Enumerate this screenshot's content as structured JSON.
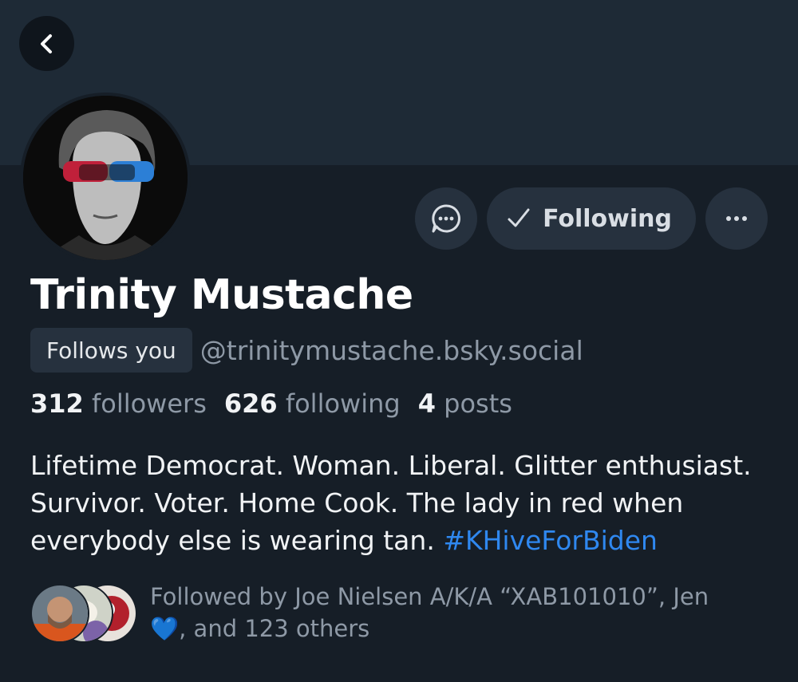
{
  "header": {
    "back_label": "Back"
  },
  "profile": {
    "display_name": "Trinity Mustache",
    "follows_you": "Follows you",
    "handle": "@trinitymustache.bsky.social"
  },
  "actions": {
    "following_label": "Following",
    "message_icon": "chat-bubble-icon",
    "more_icon": "more-horizontal-icon"
  },
  "stats": {
    "followers_count": "312",
    "followers_label": "followers",
    "following_count": "626",
    "following_label": "following",
    "posts_count": "4",
    "posts_label": "posts"
  },
  "bio": {
    "text": "Lifetime Democrat. Woman. Liberal. Glitter enthusiast. Survivor. Voter. Home Cook. The lady in red when everybody else is wearing tan. ",
    "hashtag": "#KHiveForBiden"
  },
  "followed_by": {
    "prefix": "Followed by Joe Nielsen A/K/A “XAB101010”, Jen ",
    "heart": "💙",
    "suffix": ", and 123 others"
  },
  "colors": {
    "background": "#161e27",
    "banner": "#1e2a36",
    "button": "#26313e",
    "link": "#2f88f0",
    "muted": "#8e99a6"
  }
}
